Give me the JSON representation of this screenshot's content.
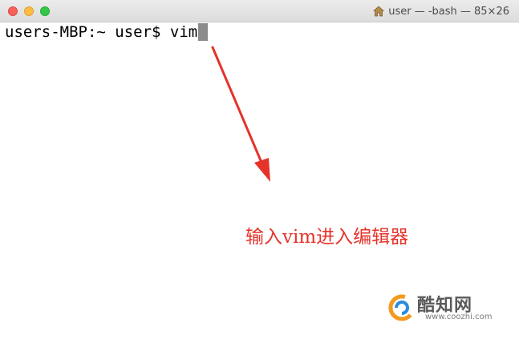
{
  "window": {
    "title": "user — -bash — 85×26",
    "title_icon": "home-icon"
  },
  "terminal": {
    "prompt": "users-MBP:~ user$ ",
    "command": "vim"
  },
  "annotation": {
    "text": "输入vim进入编辑器",
    "color": "#e5332a",
    "arrow_icon": "red-arrow-icon"
  },
  "watermark": {
    "name": "酷知网",
    "url": "www.coozhi.com",
    "logo_icon": "coozhi-logo-icon"
  },
  "colors": {
    "close": "#fc605b",
    "minimize": "#fdbc40",
    "zoom": "#34c84a",
    "cursor": "#8c8c8c"
  }
}
